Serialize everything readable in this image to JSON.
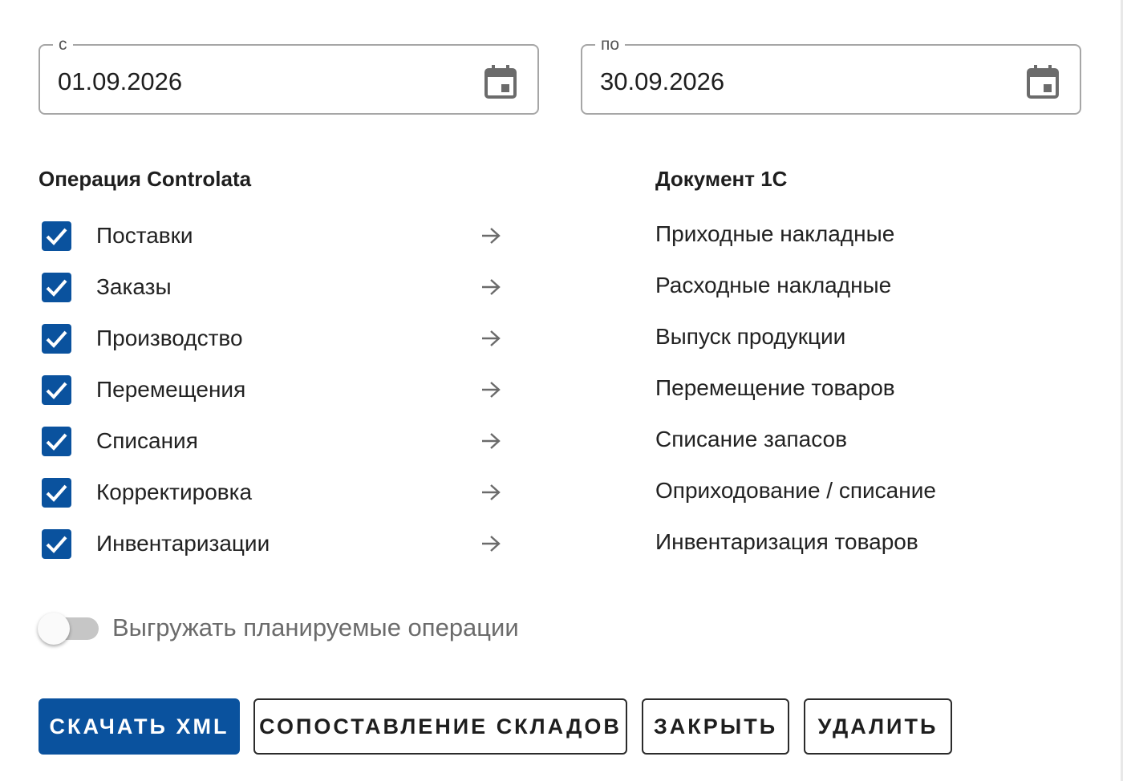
{
  "dates": {
    "from": {
      "label": "с",
      "value": "01.09.2026"
    },
    "to": {
      "label": "по",
      "value": "30.09.2026"
    }
  },
  "headers": {
    "operation": "Операция Controlata",
    "document": "Документ 1С"
  },
  "mappings": [
    {
      "operation": "Поставки",
      "document": "Приходные накладные",
      "checked": true
    },
    {
      "operation": "Заказы",
      "document": "Расходные накладные",
      "checked": true
    },
    {
      "operation": "Производство",
      "document": "Выпуск продукции",
      "checked": true
    },
    {
      "operation": "Перемещения",
      "document": "Перемещение товаров",
      "checked": true
    },
    {
      "operation": "Списания",
      "document": "Списание запасов",
      "checked": true
    },
    {
      "operation": "Корректировка",
      "document": "Оприходование / списание",
      "checked": true
    },
    {
      "operation": "Инвентаризации",
      "document": "Инвентаризация товаров",
      "checked": true
    }
  ],
  "toggle": {
    "label": "Выгружать планируемые операции",
    "on": false
  },
  "buttons": {
    "download": "СКАЧАТЬ XML",
    "warehouse_mapping": "СОПОСТАВЛЕНИЕ СКЛАДОВ",
    "close": "ЗАКРЫТЬ",
    "delete": "УДАЛИТЬ"
  },
  "colors": {
    "accent": "#0a529e",
    "border": "#a6a6a6",
    "toggle_track": "#c6c6c6",
    "muted_text": "#6b6b6b"
  },
  "icons": {
    "date_picker": "calendar-icon",
    "mapping": "arrow-right-icon",
    "checkbox": "check-icon"
  }
}
